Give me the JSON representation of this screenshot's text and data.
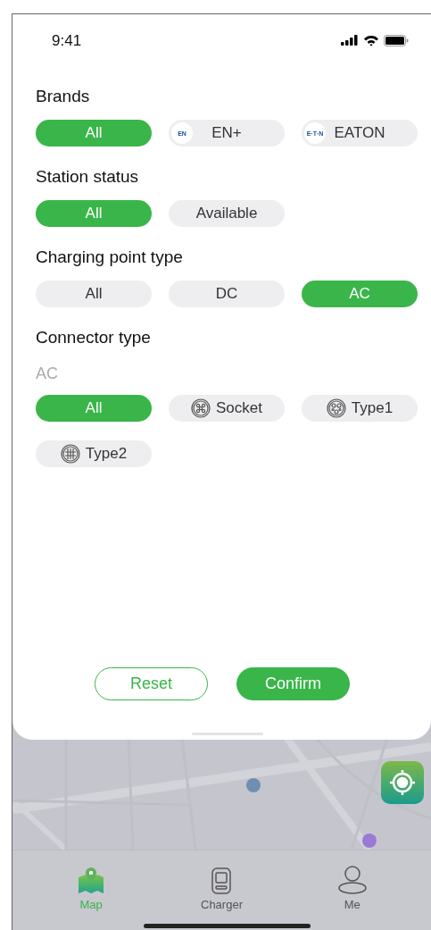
{
  "status_bar": {
    "time": "9:41"
  },
  "sections": [
    {
      "title": "Brands",
      "options": [
        {
          "label": "All",
          "selected": true
        },
        {
          "label": "EN+",
          "selected": false,
          "kind": "brand",
          "logo": "EN"
        },
        {
          "label": "EATON",
          "selected": false,
          "kind": "brand",
          "logo": "E·T·N"
        }
      ]
    },
    {
      "title": "Station status",
      "options": [
        {
          "label": "All",
          "selected": true
        },
        {
          "label": "Available",
          "selected": false
        }
      ]
    },
    {
      "title": "Charging point type",
      "options": [
        {
          "label": "All",
          "selected": false
        },
        {
          "label": "DC",
          "selected": false
        },
        {
          "label": "AC",
          "selected": true
        }
      ]
    },
    {
      "title": "Connector type",
      "subtitle": "AC",
      "options": [
        {
          "label": "All",
          "selected": true
        },
        {
          "label": "Socket",
          "selected": false,
          "kind": "socket"
        },
        {
          "label": "Type1",
          "selected": false,
          "kind": "type1"
        },
        {
          "label": "Type2",
          "selected": false,
          "kind": "type2"
        }
      ]
    }
  ],
  "buttons": [
    {
      "label": "Reset",
      "kind": "outline"
    },
    {
      "label": "Confirm",
      "kind": "filled"
    }
  ],
  "tabs": [
    {
      "label": "Map",
      "selected": true,
      "kind": "map"
    },
    {
      "label": "Charger",
      "selected": false,
      "kind": "charger"
    },
    {
      "label": "Me",
      "selected": false,
      "kind": "profile"
    }
  ]
}
